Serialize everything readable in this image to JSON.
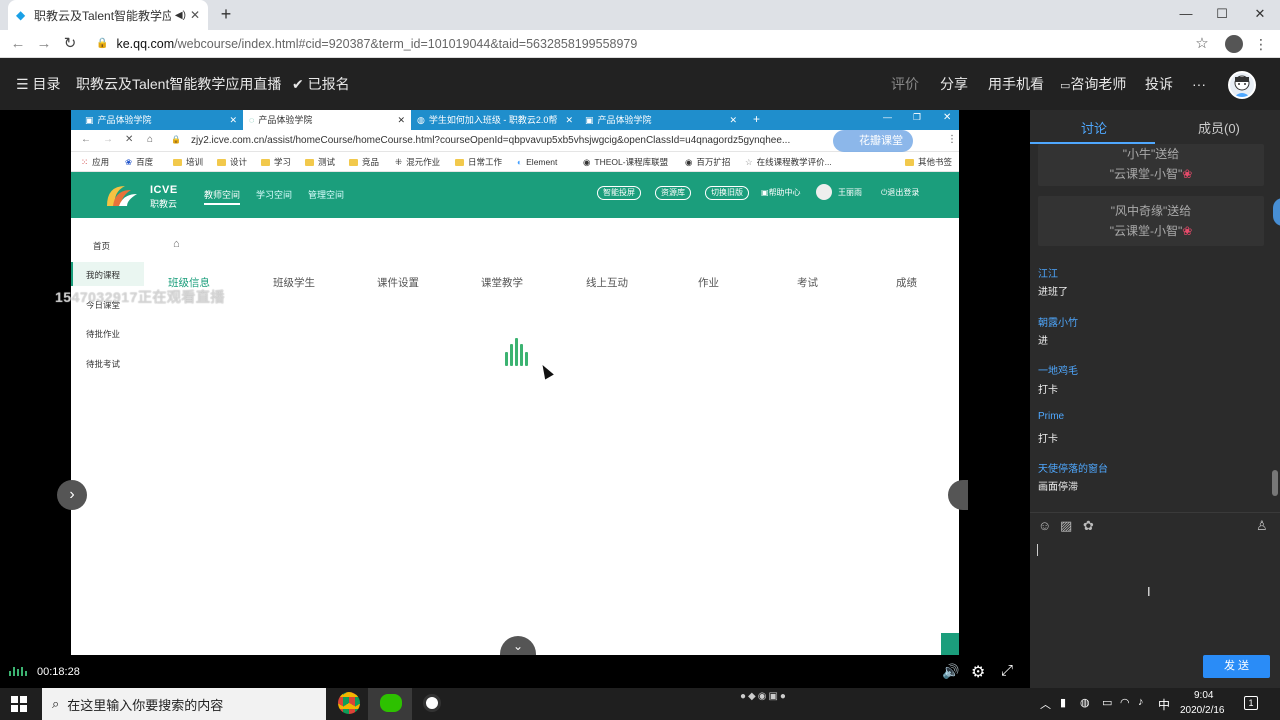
{
  "browser": {
    "tab_title": "职教云及Talent智能教学应用",
    "url_host": "ke.qq.com",
    "url_path": "/webcourse/index.html#cid=920387&term_id=101019044&taid=5632858199558979"
  },
  "site": {
    "menu_label": "目录",
    "course_title": "职教云及Talent智能教学应用直播",
    "enrolled": "已报名",
    "actions": [
      "评价",
      "分享",
      "用手机看",
      "咨询老师",
      "投诉",
      "···"
    ]
  },
  "inner_browser": {
    "tabs": [
      "产品体验学院",
      "产品体验学院",
      "学生如何加入班级 - 职教云2.0帮",
      "产品体验学院"
    ],
    "url": "zjy2.icve.com.cn/assist/homeCourse/homeCourse.html?courseOpenId=qbpvavup5xb5vhsjwgcig&openClassId=u4qnagordz5gynqhee...",
    "bookmarks": [
      "应用",
      "百度",
      "培训",
      "设计",
      "学习",
      "测试",
      "竞品",
      "混元作业",
      "日常工作",
      "Element",
      "THEOL-课程库联盟",
      "百万扩招",
      "在线课程教学评价...",
      "其他书签"
    ],
    "logo_main": "ICVE",
    "logo_sub": "职教云",
    "nav": [
      "教师空间",
      "学习空间",
      "管理空间"
    ],
    "pills": [
      "智能投屏",
      "资源库",
      "切换旧版"
    ],
    "help": "帮助中心",
    "user": "王丽雨",
    "logout": "退出登录",
    "side": [
      "首页",
      "我的课程",
      "今日课堂",
      "待批作业",
      "待批考试"
    ],
    "course_tabs": [
      "班级信息",
      "班级学生",
      "课件设置",
      "课堂教学",
      "线上互动",
      "作业",
      "考试",
      "成绩"
    ],
    "overlay_watermark": "1547032917正在观看直播",
    "floating_label": "花瓣课堂"
  },
  "player": {
    "time": "00:18:28"
  },
  "chat": {
    "tabs": [
      "讨论",
      "成员(0)"
    ],
    "gifts": [
      {
        "line1": "\"小牛\"送给",
        "line2": "\"云课堂-小智\""
      },
      {
        "line1": "\"风中奇缘\"送给",
        "line2": "\"云课堂-小智\""
      }
    ],
    "messages": [
      {
        "name": "江江",
        "text": "进班了"
      },
      {
        "name": "朝露小竹",
        "text": "进"
      },
      {
        "name": "一地鸡毛",
        "text": "打卡"
      },
      {
        "name": "Prime",
        "text": "打卡"
      },
      {
        "name": "天使停落的窗台",
        "text": "画面停滞"
      }
    ],
    "send_label": "发 送"
  },
  "taskbar": {
    "search_placeholder": "在这里输入你要搜索的内容",
    "ime": "中",
    "time": "9:04",
    "date": "2020/2/16",
    "notif": "1"
  }
}
